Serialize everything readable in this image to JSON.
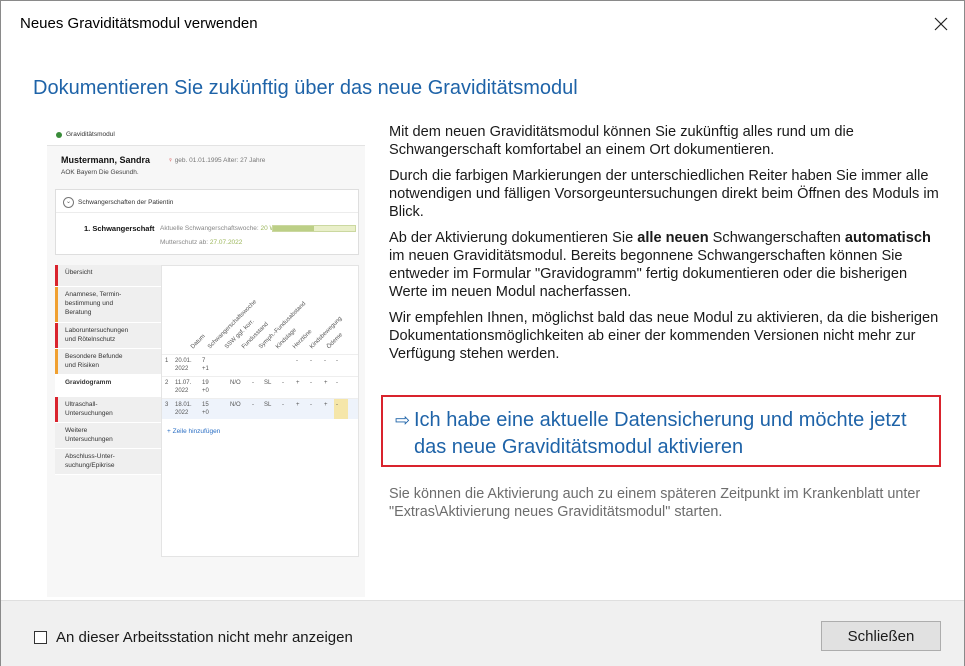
{
  "window": {
    "title": "Neues Graviditätsmodul verwenden",
    "close_icon": "close-icon"
  },
  "heading": "Dokumentieren Sie zukünftig über das neue Graviditätsmodul",
  "preview": {
    "app_title": "Graviditätsmodul",
    "patient_name": "Mustermann, Sandra",
    "patient_marker": "♀",
    "patient_dob": "geb. 01.01.1995  Alter: 27 Jahre",
    "insurance": "AOK Bayern Die Gesundh.",
    "card_title": "Schwangerschaften der Patientin",
    "pregnancy_label": "1. Schwangerschaft",
    "pregnancy_info_prefix": "Aktuelle Schwangerschaftswoche:",
    "pregnancy_info_value": "20 Wochen + 1 Tage",
    "mutterschutz_prefix": "Mutterschutz ab:",
    "mutterschutz_value": "27.07.2022",
    "progress_fraction": 0.5,
    "nav_items": [
      {
        "label": "Übersicht",
        "color": "#d9232d",
        "active": false
      },
      {
        "label": "Anamnese, Termin-\nbestimmung und\nBeratung",
        "color": "#f0a030",
        "active": false
      },
      {
        "label": "Laboruntersuchungen\nund Rötelnschutz",
        "color": "#d9232d",
        "active": false
      },
      {
        "label": "Besondere Befunde\nund Risiken",
        "color": "#f0a030",
        "active": false
      },
      {
        "label": "Gravidogramm",
        "color": "#ffffff",
        "active": true
      },
      {
        "label": "Ultraschall-\nUntersuchungen",
        "color": "#d9232d",
        "active": false
      },
      {
        "label": "Weitere\nUntersuchungen",
        "color": "#efefef",
        "active": false
      },
      {
        "label": "Abschluss-Unter-\nsuchung/Epikrise",
        "color": "#efefef",
        "active": false
      }
    ],
    "grid_columns": [
      "Datum",
      "Schwangerschaftswoche",
      "SSW ggf. korr.",
      "Fundusstand",
      "Symph.-Fundusabstand",
      "Kindslage",
      "Herztöne",
      "Kindsbewegung",
      "Ödeme"
    ],
    "grid_rows": [
      {
        "num": "1",
        "date": "20.01.\n2022",
        "week": "7\n+1",
        "values": [
          "",
          "",
          "",
          "",
          "-",
          "-",
          "-",
          "-"
        ]
      },
      {
        "num": "2",
        "date": "11.07.\n2022",
        "week": "19\n+0",
        "values": [
          "N/O",
          "-",
          "SL",
          "-",
          "+",
          "-",
          "+",
          "-"
        ]
      },
      {
        "num": "3",
        "date": "18.01.\n2022",
        "week": "15\n+0",
        "values": [
          "N/O",
          "-",
          "SL",
          "-",
          "+",
          "-",
          "+",
          "-"
        ]
      }
    ],
    "add_row_label": "+ Zeile hinzufügen"
  },
  "body": {
    "para1": "Mit dem neuen Graviditätsmodul können Sie zukünftig alles rund um die Schwangerschaft komfortabel an einem Ort dokumentieren.",
    "para2": "Durch die farbigen Markierungen der unterschiedlichen Reiter haben Sie immer alle notwendigen und fälligen Vorsorgeuntersuchungen direkt beim Öffnen des Moduls im Blick.",
    "para3_a": "Ab der Aktivierung dokumentieren Sie ",
    "para3_bold1": "alle neuen",
    "para3_b": " Schwangerschaften ",
    "para3_bold2": "automatisch",
    "para3_c": " im neuen Graviditätsmodul. Bereits begonnene Schwangerschaften können Sie entweder im Formular \"Gravidogramm\" fertig dokumentieren oder die bisherigen Werte im neuen Modul nacherfassen.",
    "para4": "Wir empfehlen Ihnen, möglichst bald das neue Modul zu aktivieren, da die bisherigen Dokumentationsmöglichkeiten ab einer der kommenden Versionen nicht mehr zur Verfügung stehen werden."
  },
  "action": {
    "arrow_icon": "⇨",
    "line1": "Ich habe eine aktuelle Datensicherung und möchte jetzt",
    "line2": "das neue Graviditätsmodul aktivieren"
  },
  "note": "Sie können die Aktivierung auch zu einem späteren Zeitpunkt im Krankenblatt unter \"Extras\\Aktivierung neues Graviditätsmodul\" starten.",
  "footer": {
    "checkbox_label": "An dieser Arbeitsstation nicht mehr anzeigen",
    "checkbox_checked": false,
    "close_button": "Schließen"
  },
  "colors": {
    "accent": "#1e63a8",
    "highlight_border": "#d9232d"
  }
}
